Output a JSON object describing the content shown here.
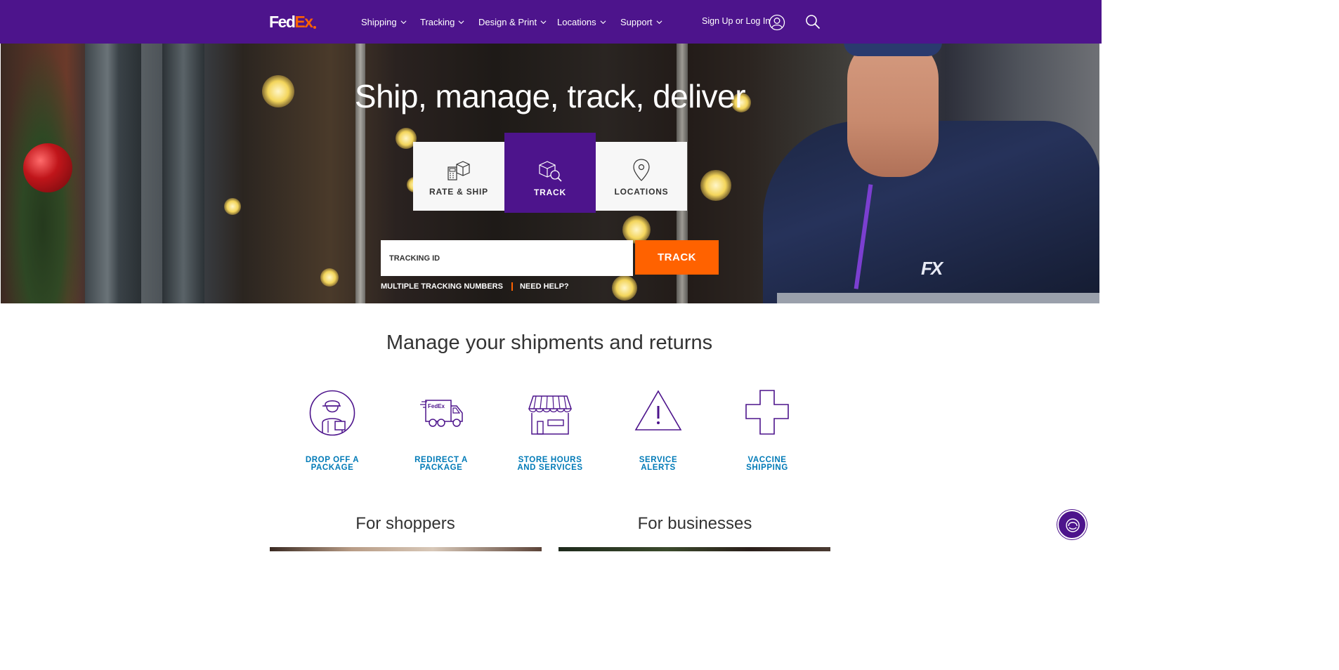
{
  "header": {
    "logo_part1": "Fed",
    "logo_part2": "Ex",
    "nav": [
      "Shipping",
      "Tracking",
      "Design & Print",
      "Locations",
      "Support"
    ],
    "signin": "Sign Up or Log In"
  },
  "hero": {
    "title": "Ship, manage, track, deliver",
    "tiles": [
      "RATE & SHIP",
      "TRACK",
      "LOCATIONS"
    ],
    "active_tile": "TRACK",
    "tracking_placeholder": "TRACKING ID",
    "track_button": "TRACK",
    "link_multiple": "MULTIPLE TRACKING NUMBERS",
    "link_help": "NEED HELP?",
    "patch_text": "FX"
  },
  "manage": {
    "title": "Manage your shipments and returns",
    "actions": [
      {
        "line1": "DROP OFF A",
        "line2": "PACKAGE",
        "icon": "person-with-package-icon"
      },
      {
        "line1": "REDIRECT A",
        "line2": "PACKAGE",
        "icon": "delivery-truck-icon"
      },
      {
        "line1": "STORE HOURS",
        "line2": "AND SERVICES",
        "icon": "store-icon"
      },
      {
        "line1": "SERVICE",
        "line2": "ALERTS",
        "icon": "alert-triangle-icon"
      },
      {
        "line1": "VACCINE",
        "line2": "SHIPPING",
        "icon": "medical-cross-icon"
      }
    ],
    "truck_text": "FedEx"
  },
  "sections": {
    "shoppers": "For shoppers",
    "businesses": "For businesses"
  },
  "colors": {
    "brand_purple": "#4d148c",
    "brand_orange": "#ff6200",
    "link_blue": "#007ab7"
  }
}
